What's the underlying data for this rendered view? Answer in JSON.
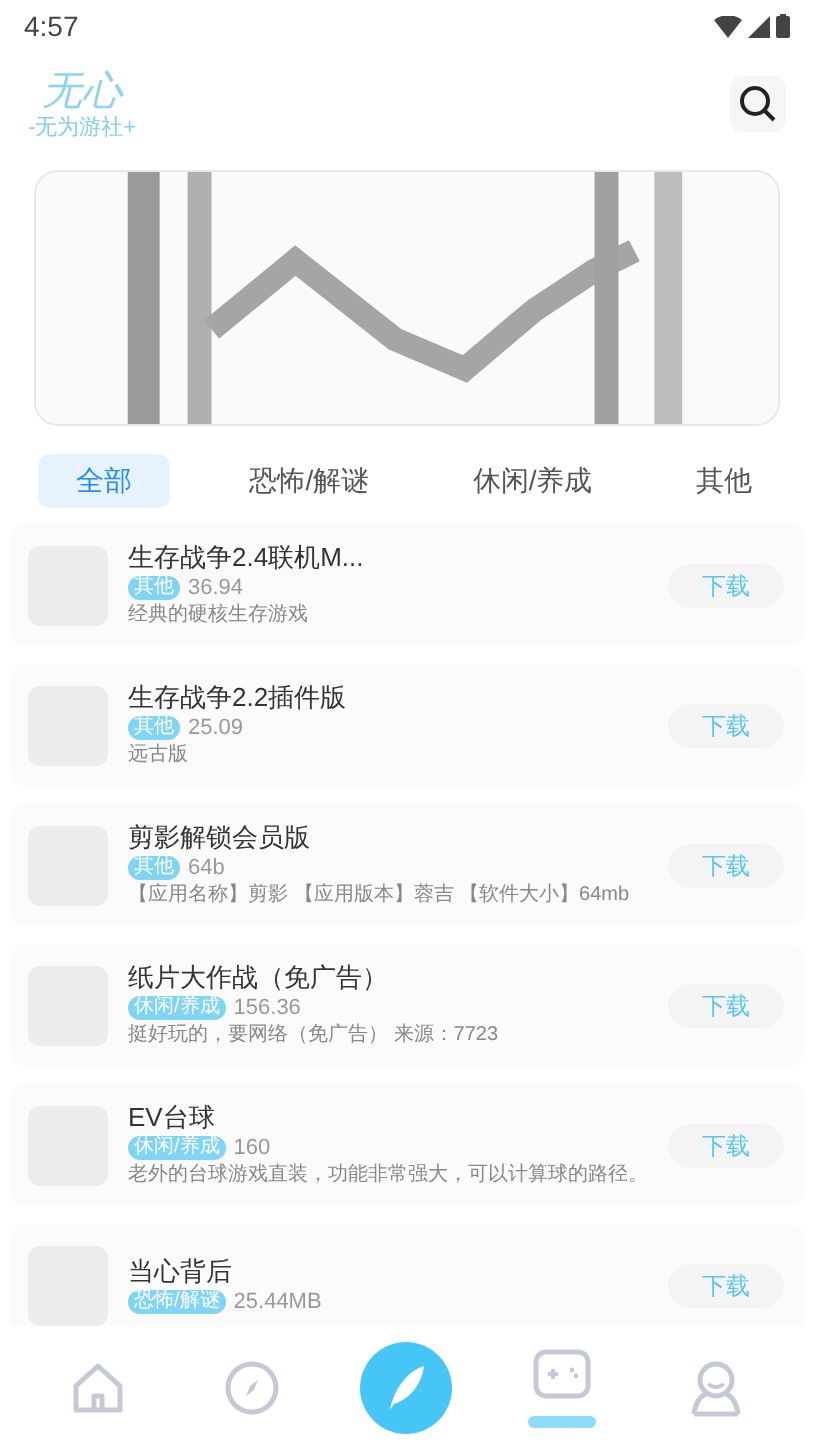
{
  "status_bar": {
    "time": "4:57"
  },
  "header": {
    "logo": "无心",
    "subtitle": "-无为游社+"
  },
  "tabs": [
    {
      "label": "全部",
      "selected": true
    },
    {
      "label": "恐怖/解谜",
      "selected": false
    },
    {
      "label": "休闲/养成",
      "selected": false
    },
    {
      "label": "其他",
      "selected": false
    }
  ],
  "apps": [
    {
      "name": "生存战争2.4联机M...",
      "tag": "其他",
      "size": "36.94",
      "description": "经典的硬核生存游戏",
      "button": "下载"
    },
    {
      "name": "生存战争2.2插件版",
      "tag": "其他",
      "size": "25.09",
      "description": "远古版",
      "button": "下载"
    },
    {
      "name": "剪影解锁会员版",
      "tag": "其他",
      "size": "64b",
      "description": "【应用名称】剪影 【应用版本】蓉吉 【软件大小】64mb",
      "button": "下载"
    },
    {
      "name": "纸片大作战（免广告）",
      "tag": "休闲/养成",
      "size": "156.36",
      "description": "挺好玩的，要网络（免广告） 来源：7723",
      "button": "下载"
    },
    {
      "name": "EV台球",
      "tag": "休闲/养成",
      "size": "160",
      "description": "老外的台球游戏直装，功能非常强大，可以计算球的路径。",
      "button": "下载"
    },
    {
      "name": "当心背后",
      "tag": "恐怖/解谜",
      "size": "25.44MB",
      "button": "下载"
    }
  ],
  "bottom_nav": [
    {
      "kind": "home",
      "selected": false
    },
    {
      "kind": "compass",
      "selected": false
    },
    {
      "kind": "feather",
      "selected": false
    },
    {
      "kind": "gamepad",
      "selected": true
    },
    {
      "kind": "person",
      "selected": false
    }
  ]
}
